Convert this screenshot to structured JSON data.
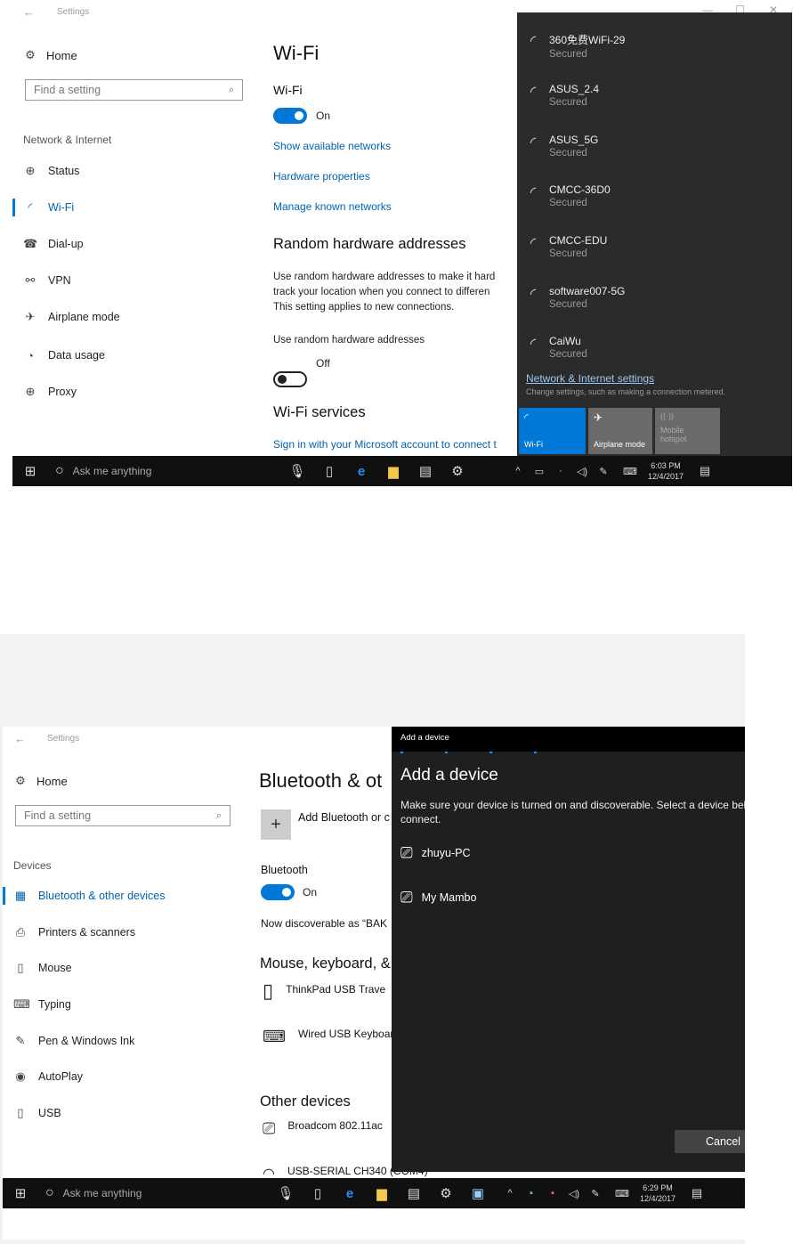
{
  "shot1": {
    "window_title": "Settings",
    "home": "Home",
    "search_placeholder": "Find a setting",
    "section": "Network & Internet",
    "nav": [
      {
        "label": "Status",
        "icon": "globe-icon"
      },
      {
        "label": "Wi-Fi",
        "icon": "wifi-icon",
        "active": true
      },
      {
        "label": "Dial-up",
        "icon": "phone-icon"
      },
      {
        "label": "VPN",
        "icon": "vpn-icon"
      },
      {
        "label": "Airplane mode",
        "icon": "airplane-icon"
      },
      {
        "label": "Data usage",
        "icon": "pie-icon"
      },
      {
        "label": "Proxy",
        "icon": "globe-icon"
      }
    ],
    "main": {
      "title": "Wi-Fi",
      "wifi_label": "Wi-Fi",
      "wifi_state": "On",
      "link_show": "Show available networks",
      "link_hw": "Hardware properties",
      "link_known": "Manage known networks",
      "random_title": "Random hardware addresses",
      "random_desc_1": "Use random hardware addresses to make it hard",
      "random_desc_2": "track your location when you connect to differen",
      "random_desc_3": "This setting applies to new connections.",
      "random_label": "Use random hardware addresses",
      "random_state": "Off",
      "services_title": "Wi-Fi services",
      "services_link": "Sign in with your Microsoft account to connect t"
    },
    "flyout": {
      "networks": [
        {
          "name": "360免费WiFi-29",
          "status": "Secured"
        },
        {
          "name": "ASUS_2.4",
          "status": "Secured"
        },
        {
          "name": "ASUS_5G",
          "status": "Secured"
        },
        {
          "name": "CMCC-36D0",
          "status": "Secured"
        },
        {
          "name": "CMCC-EDU",
          "status": "Secured"
        },
        {
          "name": "software007-5G",
          "status": "Secured"
        },
        {
          "name": "CaiWu",
          "status": "Secured"
        }
      ],
      "settings_link": "Network & Internet settings",
      "settings_desc": "Change settings, such as making a connection metered.",
      "tile_wifi": "Wi-Fi",
      "tile_airplane": "Airplane mode",
      "tile_hotspot_1": "Mobile",
      "tile_hotspot_2": "hotspot"
    },
    "taskbar": {
      "search": "Ask me anything",
      "time": "6:03 PM",
      "date": "12/4/2017"
    }
  },
  "shot2": {
    "window_title": "Settings",
    "home": "Home",
    "search_placeholder": "Find a setting",
    "section": "Devices",
    "nav": [
      {
        "label": "Bluetooth & other devices",
        "icon": "bluetooth-devices-icon",
        "active": true
      },
      {
        "label": "Printers & scanners",
        "icon": "printer-icon"
      },
      {
        "label": "Mouse",
        "icon": "mouse-icon"
      },
      {
        "label": "Typing",
        "icon": "keyboard-icon"
      },
      {
        "label": "Pen & Windows Ink",
        "icon": "pen-icon"
      },
      {
        "label": "AutoPlay",
        "icon": "autoplay-icon"
      },
      {
        "label": "USB",
        "icon": "usb-icon"
      }
    ],
    "main": {
      "title": "Bluetooth & ot",
      "add_label": "Add Bluetooth or c",
      "bt_label": "Bluetooth",
      "bt_state": "On",
      "discoverable": "Now discoverable as “BAK",
      "mouse_section": "Mouse, keyboard, &",
      "dev_mouse": "ThinkPad USB Trave",
      "dev_keyboard": "Wired USB Keyboar",
      "other_section": "Other devices",
      "dev_broadcom": "Broadcom 802.11ac",
      "dev_usb": "USB-SERIAL CH340 (COM4)"
    },
    "dialog": {
      "titlebar": "Add a device",
      "heading": "Add a device",
      "desc": "Make sure your device is turned on and discoverable. Select a device below to connect.",
      "devices": [
        "zhuyu-PC",
        "My Mambo"
      ],
      "cancel": "Cancel"
    },
    "taskbar": {
      "search": "Ask me anything",
      "time": "6:29 PM",
      "date": "12/4/2017"
    }
  }
}
